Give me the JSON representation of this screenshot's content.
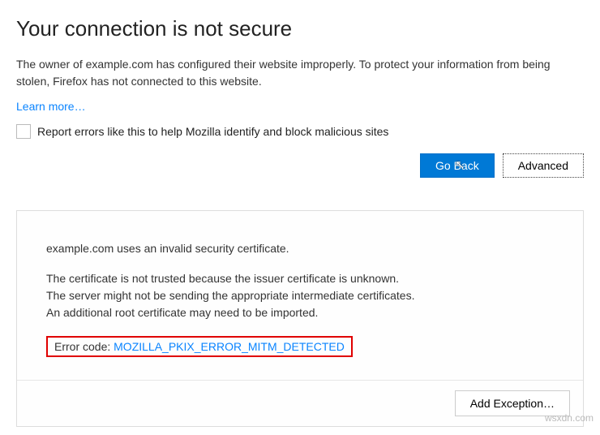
{
  "title": "Your connection is not secure",
  "description": "The owner of example.com has configured their website improperly. To protect your information from being stolen, Firefox has not connected to this website.",
  "learn_more": "Learn more…",
  "report_label": "Report errors like this to help Mozilla identify and block malicious sites",
  "go_back": "Go Back",
  "advanced": "Advanced",
  "details": {
    "line1": "example.com uses an invalid security certificate.",
    "line2": "The certificate is not trusted because the issuer certificate is unknown.",
    "line3": "The server might not be sending the appropriate intermediate certificates.",
    "line4": "An additional root certificate may need to be imported.",
    "error_label": "Error code: ",
    "error_code": "MOZILLA_PKIX_ERROR_MITM_DETECTED"
  },
  "add_exception": "Add Exception…",
  "watermark": "wsxdn.com"
}
